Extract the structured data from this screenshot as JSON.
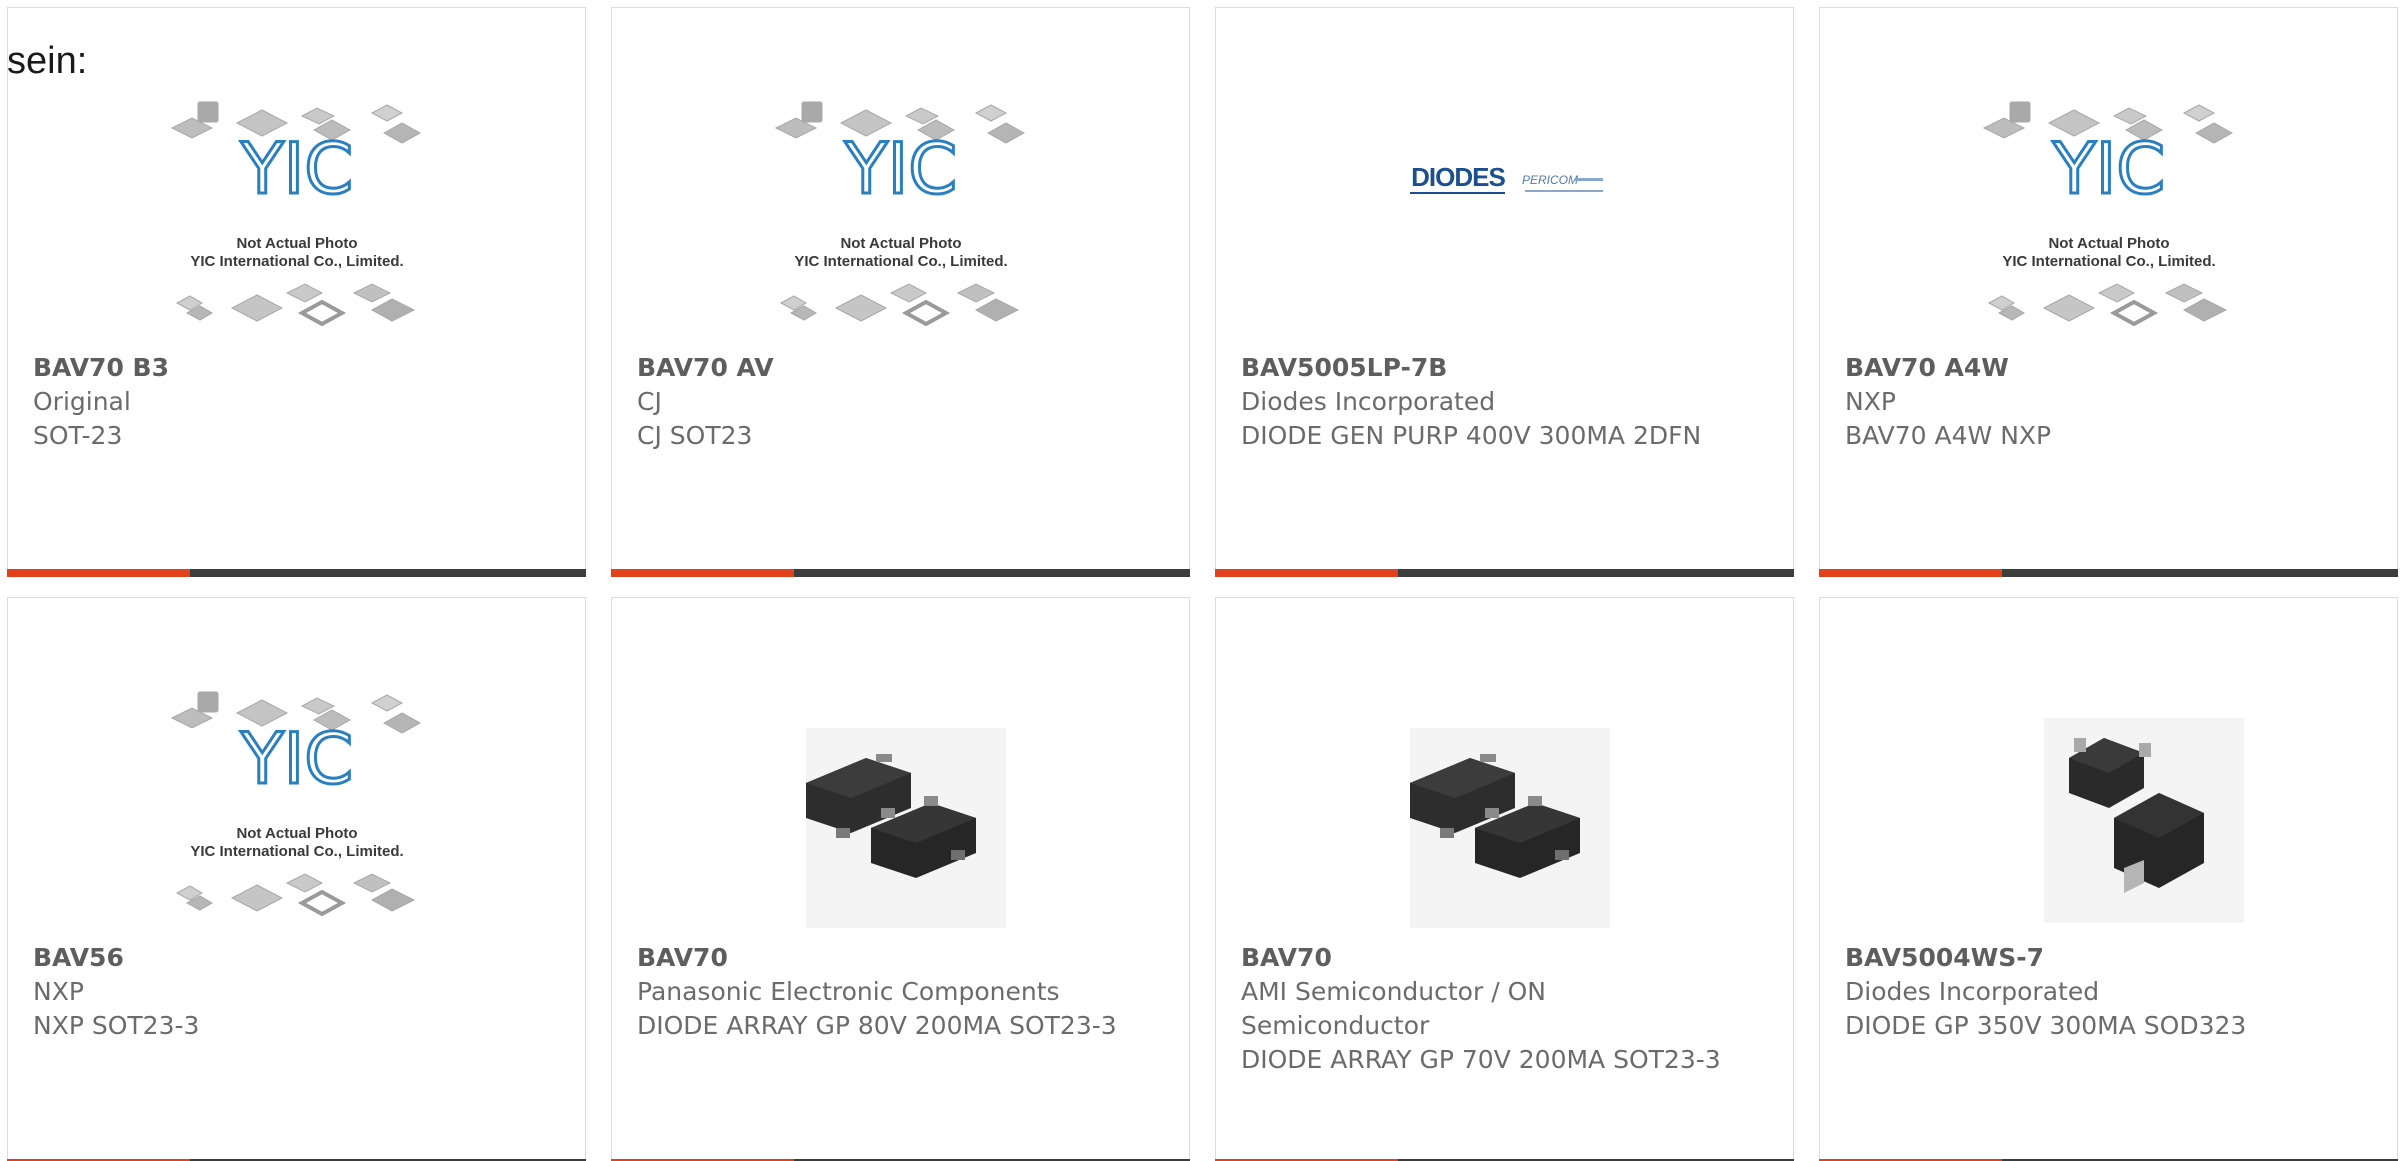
{
  "heading": "sein:",
  "placeholder": {
    "line1": "Not Actual Photo",
    "line2": "YIC International Co., Limited.",
    "logo": "YIC"
  },
  "diodes_logo": {
    "main": "DIODES",
    "sub": "PERICOM"
  },
  "colors": {
    "accent": "#e2421b",
    "bar": "#3d3d3d",
    "text": "#6b6b6b"
  },
  "products": [
    {
      "part": "BAV70 B3",
      "manufacturer": "Original",
      "description": "SOT-23",
      "image": "placeholder"
    },
    {
      "part": "BAV70 AV",
      "manufacturer": "CJ",
      "description": "CJ SOT23",
      "image": "placeholder"
    },
    {
      "part": "BAV5005LP-7B",
      "manufacturer": "Diodes Incorporated",
      "description": "DIODE GEN PURP 400V 300MA 2DFN",
      "image": "diodes-logo"
    },
    {
      "part": "BAV70 A4W",
      "manufacturer": "NXP",
      "description": "BAV70 A4W NXP",
      "image": "placeholder"
    },
    {
      "part": "BAV56",
      "manufacturer": "NXP",
      "description": "NXP SOT23-3",
      "image": "placeholder"
    },
    {
      "part": "BAV70",
      "manufacturer": "Panasonic Electronic Components",
      "description": "DIODE ARRAY GP 80V 200MA SOT23-3",
      "image": "sot23"
    },
    {
      "part": "BAV70",
      "manufacturer": "AMI Semiconductor / ON Semiconductor",
      "description": "DIODE ARRAY GP 70V 200MA SOT23-3",
      "image": "sot23"
    },
    {
      "part": "BAV5004WS-7",
      "manufacturer": "Diodes Incorporated",
      "description": "DIODE GP 350V 300MA SOD323",
      "image": "sod323"
    }
  ]
}
